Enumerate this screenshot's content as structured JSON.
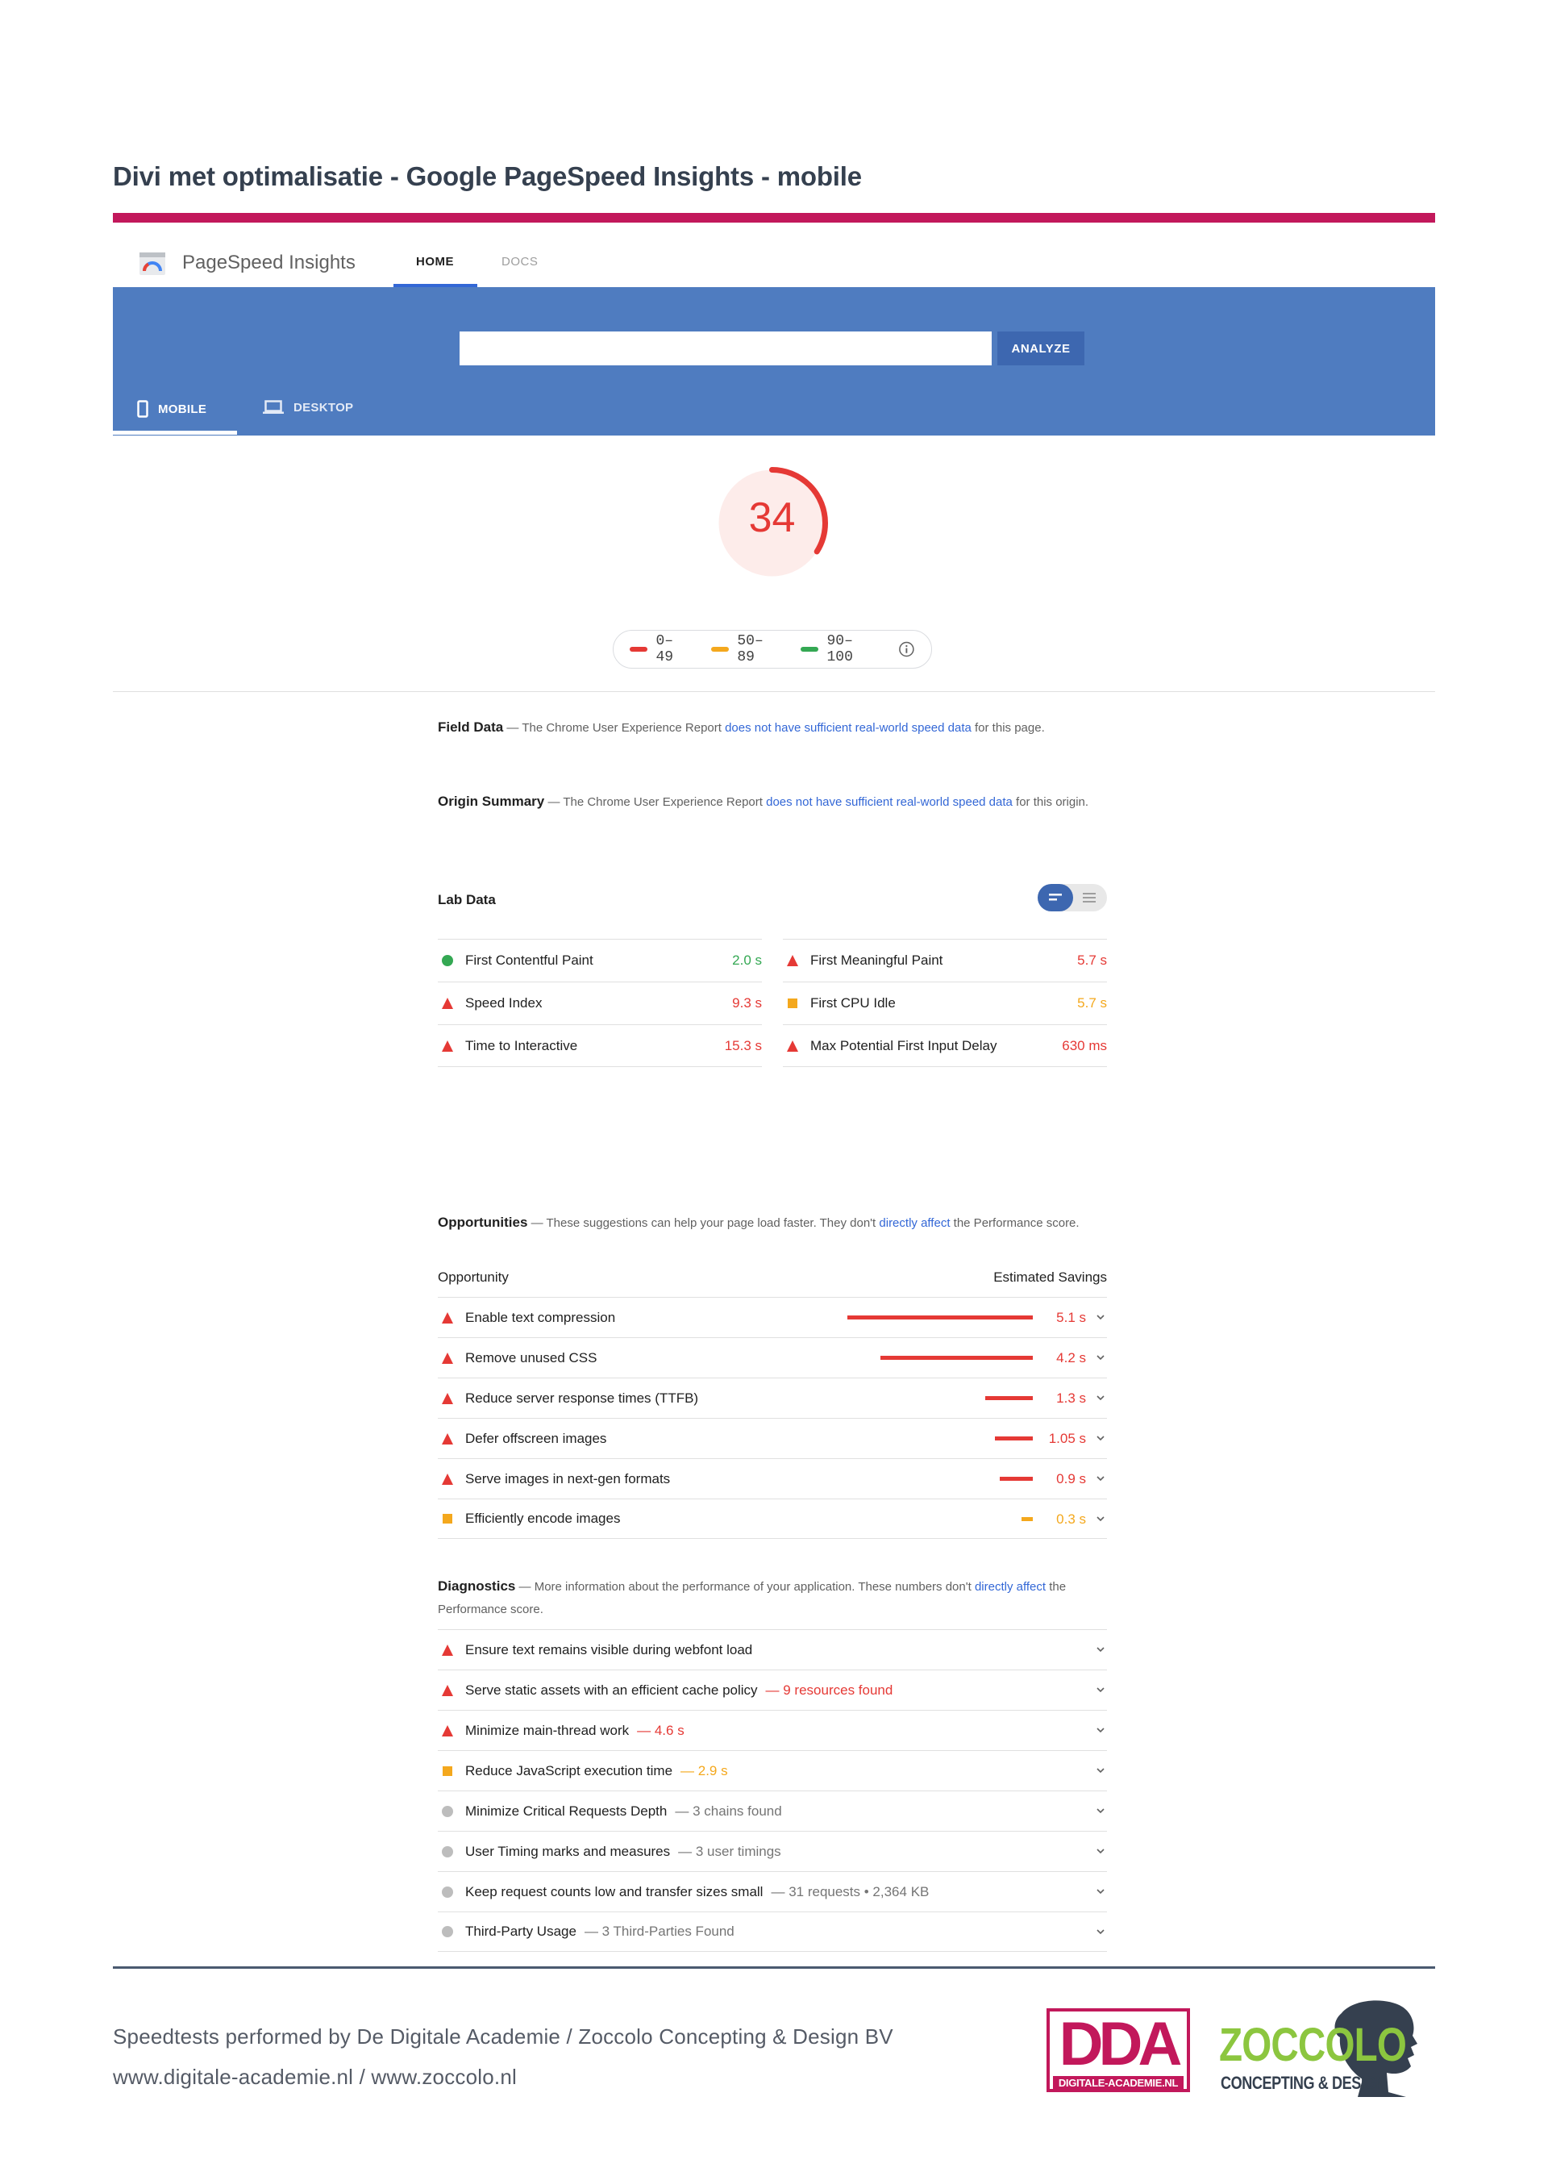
{
  "doc": {
    "title": "Divi met optimalisatie - Google PageSpeed Insights - mobile",
    "accent_color": "#c2185b"
  },
  "psi": {
    "brand": "PageSpeed Insights",
    "nav": {
      "home": "HOME",
      "docs": "DOCS"
    },
    "band_color": "#4f7cc0",
    "analyze_color": "#3d67b0",
    "url_input": {
      "value": "",
      "placeholder": ""
    },
    "analyze_label": "ANALYZE",
    "device_tabs": {
      "mobile": "MOBILE",
      "desktop": "DESKTOP"
    }
  },
  "score": {
    "value": "34",
    "fraction": 0.34,
    "color": "#e53935",
    "bg_color": "#fdecea"
  },
  "legend": {
    "items": [
      {
        "label": "0–49",
        "color": "#e53935"
      },
      {
        "label": "50–89",
        "color": "#f4a81d"
      },
      {
        "label": "90–100",
        "color": "#34a853"
      }
    ]
  },
  "field_data": {
    "title": "Field Data",
    "prefix": "— The Chrome User Experience Report ",
    "link": "does not have sufficient real-world speed data",
    "suffix": " for this page."
  },
  "origin_summary": {
    "title": "Origin Summary",
    "prefix": "— The Chrome User Experience Report ",
    "link": "does not have sufficient real-world speed data",
    "suffix": " for this origin."
  },
  "lab_data": {
    "title": "Lab Data",
    "left": [
      {
        "name": "First Contentful Paint",
        "value": "2.0 s",
        "status": "pass"
      },
      {
        "name": "Speed Index",
        "value": "9.3 s",
        "status": "fail"
      },
      {
        "name": "Time to Interactive",
        "value": "15.3 s",
        "status": "fail"
      }
    ],
    "right": [
      {
        "name": "First Meaningful Paint",
        "value": "5.7 s",
        "status": "fail"
      },
      {
        "name": "First CPU Idle",
        "value": "5.7 s",
        "status": "average"
      },
      {
        "name": "Max Potential First Input Delay",
        "value": "630 ms",
        "status": "fail"
      }
    ]
  },
  "opportunities": {
    "title": "Opportunities",
    "prefix": "— These suggestions can help your page load faster. They don't ",
    "link": "directly affect",
    "suffix": " the Performance score.",
    "col_left": "Opportunity",
    "col_right": "Estimated Savings",
    "items": [
      {
        "name": "Enable text compression",
        "value": "5.1 s",
        "seconds": 5.1,
        "status": "fail"
      },
      {
        "name": "Remove unused CSS",
        "value": "4.2 s",
        "seconds": 4.2,
        "status": "fail"
      },
      {
        "name": "Reduce server response times (TTFB)",
        "value": "1.3 s",
        "seconds": 1.3,
        "status": "fail"
      },
      {
        "name": "Defer offscreen images",
        "value": "1.05 s",
        "seconds": 1.05,
        "status": "fail"
      },
      {
        "name": "Serve images in next-gen formats",
        "value": "0.9 s",
        "seconds": 0.9,
        "status": "fail"
      },
      {
        "name": "Efficiently encode images",
        "value": "0.3 s",
        "seconds": 0.3,
        "status": "average"
      }
    ]
  },
  "diagnostics": {
    "title": "Diagnostics",
    "prefix": "— More information about the performance of your application. These numbers don't ",
    "link": "directly affect",
    "suffix": " the Performance score.",
    "items": [
      {
        "name": "Ensure text remains visible during webfont load",
        "detail": "",
        "status": "fail"
      },
      {
        "name": "Serve static assets with an efficient cache policy",
        "detail": "— 9 resources found",
        "status": "fail"
      },
      {
        "name": "Minimize main-thread work",
        "detail": "— 4.6 s",
        "status": "fail"
      },
      {
        "name": "Reduce JavaScript execution time",
        "detail": "— 2.9 s",
        "status": "average"
      },
      {
        "name": "Minimize Critical Requests Depth",
        "detail": "— 3 chains found",
        "status": "info"
      },
      {
        "name": "User Timing marks and measures",
        "detail": "— 3 user timings",
        "status": "info"
      },
      {
        "name": "Keep request counts low and transfer sizes small",
        "detail": "— 31 requests • 2,364 KB",
        "status": "info"
      },
      {
        "name": "Third-Party Usage",
        "detail": "— 3 Third-Parties Found",
        "status": "info"
      }
    ]
  },
  "status_colors": {
    "pass": "#34a853",
    "fail": "#e53935",
    "average": "#f4a81d",
    "info": "#bdbdbd"
  },
  "footer": {
    "line1": "Speedtests performed by De Digitale Academie / Zoccolo Concepting & Design BV",
    "line2": "www.digitale-academie.nl / www.zoccolo.nl"
  },
  "logos": {
    "dda_big": "DDA",
    "dda_small": "DIGITALE-ACADEMIE.NL",
    "zoccolo_name": "ZOCCOLO",
    "zoccolo_sub": "CONCEPTING & DESIGN"
  }
}
